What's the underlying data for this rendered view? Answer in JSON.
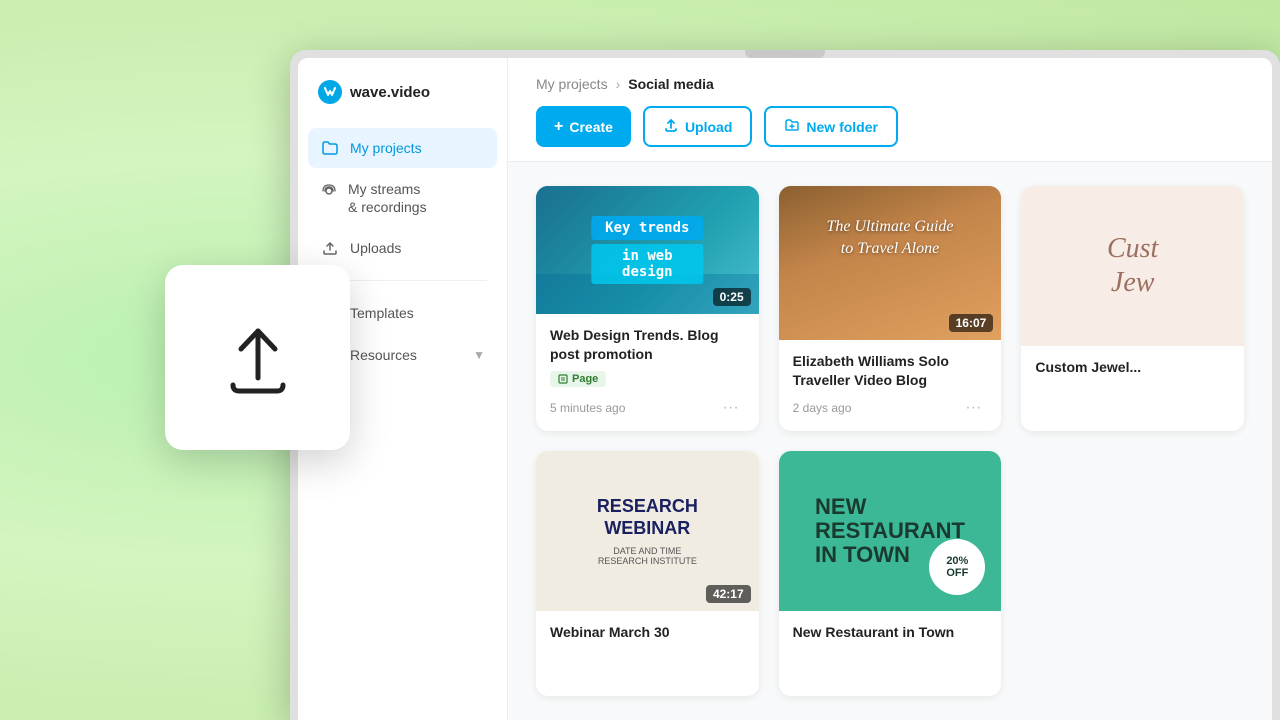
{
  "app": {
    "name": "wave.video",
    "logo_letter": "w"
  },
  "sidebar": {
    "items": [
      {
        "id": "my-projects",
        "label": "My projects",
        "active": true
      },
      {
        "id": "my-streams",
        "label": "My streams\n& recordings",
        "active": false
      },
      {
        "id": "uploads",
        "label": "Uploads",
        "active": false
      },
      {
        "id": "templates",
        "label": "Templates",
        "active": false
      },
      {
        "id": "resources",
        "label": "Resources",
        "active": false,
        "has_arrow": true
      }
    ]
  },
  "breadcrumb": {
    "parent": "My projects",
    "separator": ">",
    "current": "Social media"
  },
  "toolbar": {
    "create_label": "Create",
    "upload_label": "Upload",
    "new_folder_label": "New folder"
  },
  "cards": [
    {
      "id": "web-design",
      "title": "Web Design Trends. Blog post promotion",
      "thumb_type": "webdesign",
      "thumb_line1": "Key trends",
      "thumb_line2": "in web design",
      "duration": "0:25",
      "tag": "Page",
      "time_ago": "5 minutes ago"
    },
    {
      "id": "travel-blog",
      "title": "Elizabeth Williams Solo Traveller Video Blog",
      "thumb_type": "travel",
      "thumb_line1": "The Ultimate Guide",
      "thumb_line2": "to Travel Alone",
      "duration": "16:07",
      "tag": null,
      "time_ago": "2 days ago"
    },
    {
      "id": "jewelry",
      "title": "Custom Jewelry",
      "thumb_type": "jewelry",
      "thumb_line1": "Cust...",
      "thumb_line2": "Jew...",
      "duration": null,
      "tag": null,
      "time_ago": ""
    },
    {
      "id": "webinar",
      "title": "Webinar March 30",
      "thumb_type": "webinar",
      "thumb_line1": "RESEARCH",
      "thumb_line2": "WEBINAR",
      "thumb_sub": "DATE AND TIME\nRESEARCH INSTITUTE",
      "duration": "42:17",
      "tag": null,
      "time_ago": ""
    },
    {
      "id": "restaurant",
      "title": "New Restaurant in Town",
      "thumb_type": "restaurant",
      "thumb_line1": "NEW",
      "thumb_line2": "RESTAURANT",
      "thumb_line3": "IN TOWN",
      "badge_line1": "20%",
      "badge_line2": "OFF",
      "duration": null,
      "tag": null,
      "time_ago": ""
    }
  ],
  "upload_tooltip": {
    "visible": true
  },
  "colors": {
    "primary": "#00aaee",
    "active_bg": "#e8f4ff",
    "active_text": "#0099dd"
  }
}
